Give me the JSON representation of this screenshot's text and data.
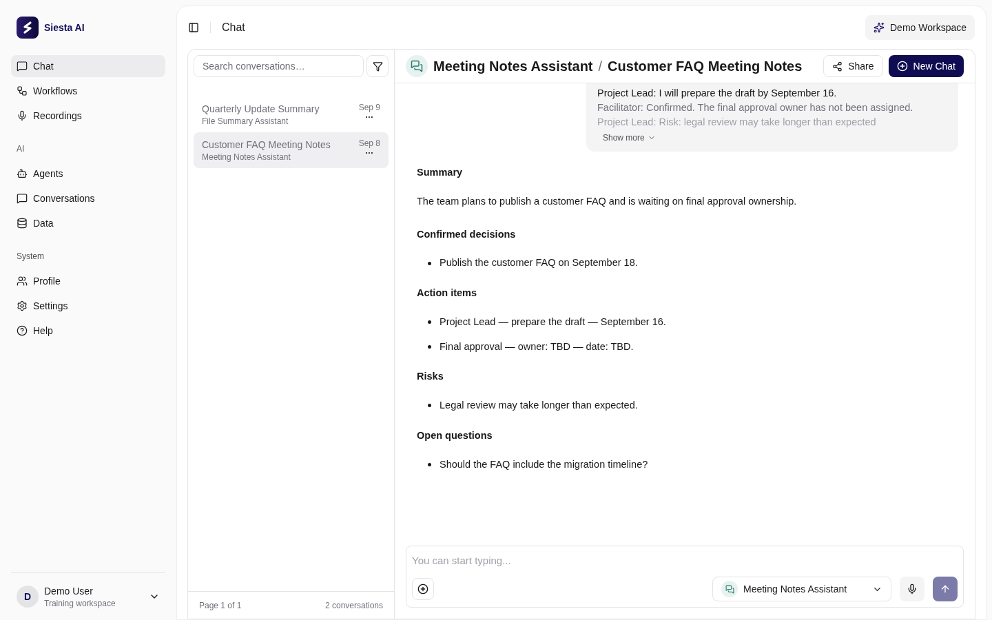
{
  "brand": {
    "name": "Siesta AI"
  },
  "nav": [
    {
      "label": "Chat",
      "selected": true
    },
    {
      "label": "Workflows",
      "selected": false
    },
    {
      "label": "Recordings",
      "selected": false
    }
  ],
  "sections": [
    {
      "title": "AI",
      "items": [
        {
          "label": "Agents",
          "selected": false
        },
        {
          "label": "Conversations",
          "selected": false
        },
        {
          "label": "Data",
          "selected": false
        }
      ]
    },
    {
      "title": "System",
      "items": [
        {
          "label": "Profile",
          "selected": false
        },
        {
          "label": "Settings",
          "selected": false
        },
        {
          "label": "Help",
          "selected": false
        }
      ]
    }
  ],
  "user": {
    "initial": "D",
    "name": "Demo User",
    "workspace": "Training workspace"
  },
  "header": {
    "title": "Chat",
    "workspace_button": "Demo Workspace"
  },
  "conversation_list": {
    "search_placeholder": "Search conversations…",
    "items": [
      {
        "title": "Quarterly Update Summary",
        "assistant": "File Summary Assistant",
        "date": "Sep 9",
        "menu": "···",
        "selected": false
      },
      {
        "title": "Customer FAQ Meeting Notes",
        "assistant": "Meeting Notes Assistant",
        "date": "Sep 8",
        "menu": "···",
        "selected": true
      }
    ],
    "page": "Page 1 of 1",
    "count": "2 conversations"
  },
  "chat": {
    "assistant": "Meeting Notes Assistant",
    "separator": "/",
    "title": "Customer FAQ Meeting Notes",
    "share": "Share",
    "new_chat": "New Chat",
    "user_message": {
      "lines": [
        {
          "text": "Project Lead: I will prepare the draft by September 16.",
          "faded": false
        },
        {
          "text": "Facilitator: Confirmed. The final approval owner has not been assigned.",
          "faded": false
        },
        {
          "text": "Project Lead: Risk: legal review may take longer than expected",
          "faded": true
        }
      ],
      "show_more": "Show more"
    },
    "reply": [
      {
        "kind": "heading",
        "text": "Summary"
      },
      {
        "kind": "paragraph",
        "text": "The team plans to publish a customer FAQ and is waiting on final approval ownership."
      },
      {
        "kind": "heading",
        "text": "Confirmed decisions"
      },
      {
        "kind": "list",
        "items": [
          "Publish the customer FAQ on September 18."
        ]
      },
      {
        "kind": "heading",
        "text": "Action items"
      },
      {
        "kind": "list",
        "items": [
          "Project Lead — prepare the draft — September 16.",
          "Final approval — owner: TBD — date: TBD."
        ]
      },
      {
        "kind": "heading",
        "text": "Risks"
      },
      {
        "kind": "list",
        "items": [
          "Legal review may take longer than expected."
        ]
      },
      {
        "kind": "heading",
        "text": "Open questions"
      },
      {
        "kind": "list",
        "items": [
          "Should the FAQ include the migration timeline?"
        ]
      }
    ],
    "composer": {
      "placeholder": "You can start typing...",
      "assistant": "Meeting Notes Assistant"
    }
  }
}
